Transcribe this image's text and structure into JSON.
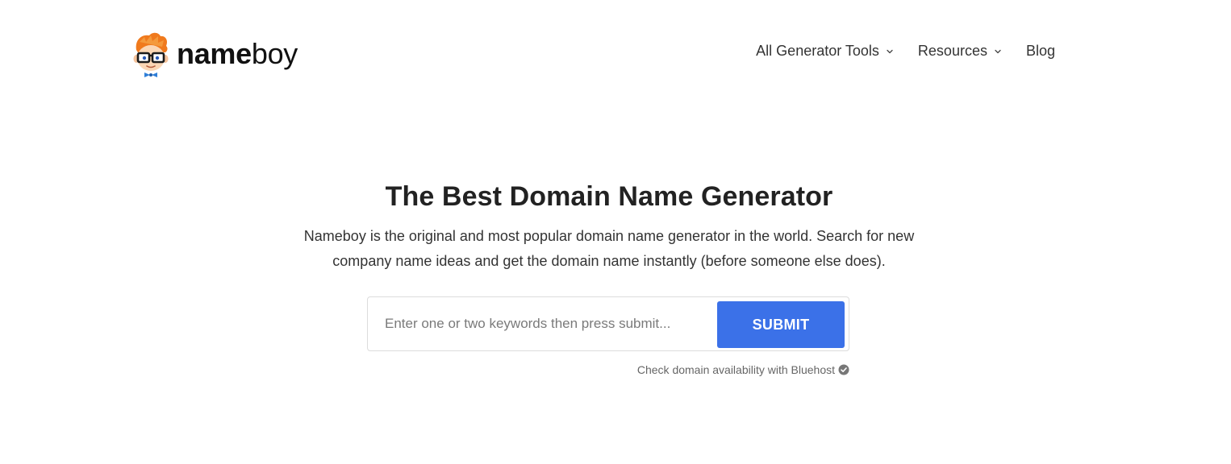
{
  "brand": {
    "name_bold": "name",
    "name_light": "boy"
  },
  "nav": {
    "items": [
      {
        "label": "All Generator Tools",
        "has_dropdown": true,
        "icon": "chevron-down-icon"
      },
      {
        "label": "Resources",
        "has_dropdown": true,
        "icon": "chevron-down-icon"
      },
      {
        "label": "Blog",
        "has_dropdown": false
      }
    ]
  },
  "hero": {
    "title": "The Best Domain Name Generator",
    "description": "Nameboy is the original and most popular domain name generator in the world. Search for new company name ideas and get the domain name instantly (before someone else does)."
  },
  "search": {
    "value": "",
    "placeholder": "Enter one or two keywords then press submit...",
    "submit_label": "SUBMIT"
  },
  "availability": {
    "text": "Check domain availability with Bluehost",
    "icon": "check-circle-icon"
  },
  "colors": {
    "accent": "#3b71e8",
    "text": "#2b2b2b",
    "muted": "#666666",
    "border": "#dcdcdc",
    "mascot_hair": "#f07a1d"
  }
}
